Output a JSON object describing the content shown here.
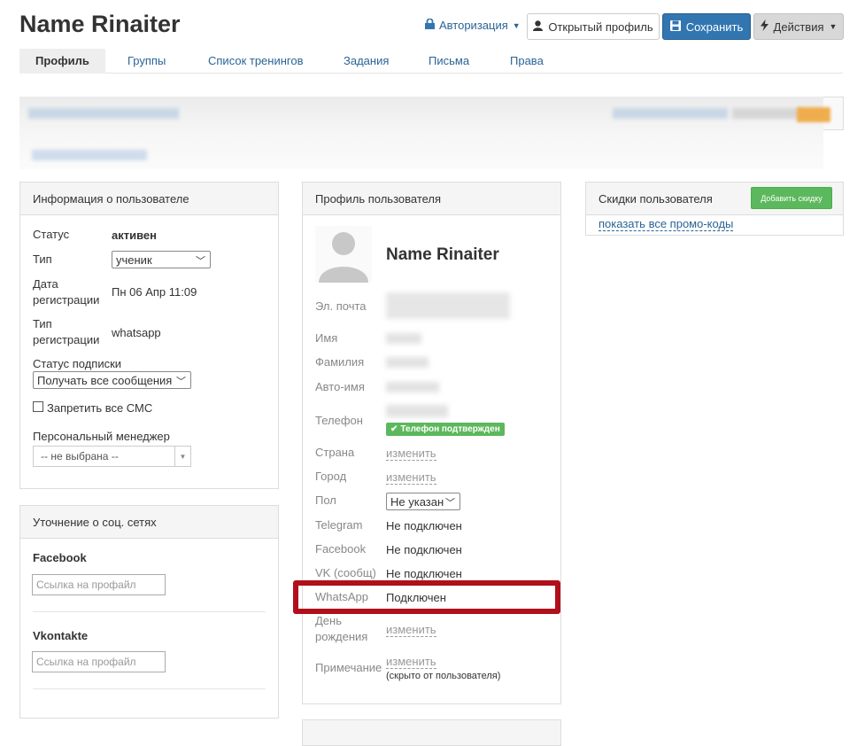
{
  "header": {
    "title": "Name Rinaiter",
    "auth_link": "Авторизация",
    "open_profile": "Открытый профиль",
    "save": "Сохранить",
    "actions": "Действия"
  },
  "tabs": [
    "Профиль",
    "Группы",
    "Список тренингов",
    "Задания",
    "Письма",
    "Права"
  ],
  "user_info": {
    "title": "Информация о пользователе",
    "status_label": "Статус",
    "status_value": "активен",
    "type_label": "Тип",
    "type_value": "ученик",
    "reg_date_label_1": "Дата",
    "reg_date_label_2": "регистрации",
    "reg_date_value": "Пн 06 Апр 11:09",
    "reg_type_label_1": "Тип",
    "reg_type_label_2": "регистрации",
    "reg_type_value": "whatsapp",
    "subscription_label": "Статус подписки",
    "subscription_value": "Получать все сообщения",
    "ban_sms_label": "Запретить все СМС",
    "manager_label": "Персональный менеджер",
    "manager_value": "-- не выбрана --"
  },
  "social": {
    "title": "Уточнение о соц. сетях",
    "facebook_label": "Facebook",
    "facebook_placeholder": "Ссылка на профайл",
    "vk_label": "Vkontakte",
    "vk_placeholder": "Ссылка на профайл"
  },
  "profile": {
    "title": "Профиль пользователя",
    "name": "Name Rinaiter",
    "email_label": "Эл. почта",
    "first_name_label": "Имя",
    "last_name_label": "Фамилия",
    "auto_name_label": "Авто-имя",
    "phone_label": "Телефон",
    "phone_verified": "Телефон подтвержден",
    "country_label": "Страна",
    "country_value": "изменить",
    "city_label": "Город",
    "city_value": "изменить",
    "gender_label": "Пол",
    "gender_value": "Не указан",
    "telegram_label": "Telegram",
    "telegram_value": "Не подключен",
    "facebook_label": "Facebook",
    "facebook_value": "Не подключен",
    "vk_label": "VK (сообщ)",
    "vk_value": "Не подключен",
    "whatsapp_label": "WhatsApp",
    "whatsapp_value": "Подключен",
    "birthday_label_1": "День",
    "birthday_label_2": "рождения",
    "birthday_value": "изменить",
    "note_label": "Примечание",
    "note_value": "изменить",
    "note_hint": "(скрыто от пользователя)"
  },
  "discounts": {
    "title": "Скидки пользователя",
    "add_button": "Добавить скидку",
    "show_promo": "показать все промо-коды"
  },
  "colors": {
    "primary": "#3276b1",
    "link": "#2a6496",
    "success": "#5cb85c",
    "highlight": "#b0101b"
  }
}
